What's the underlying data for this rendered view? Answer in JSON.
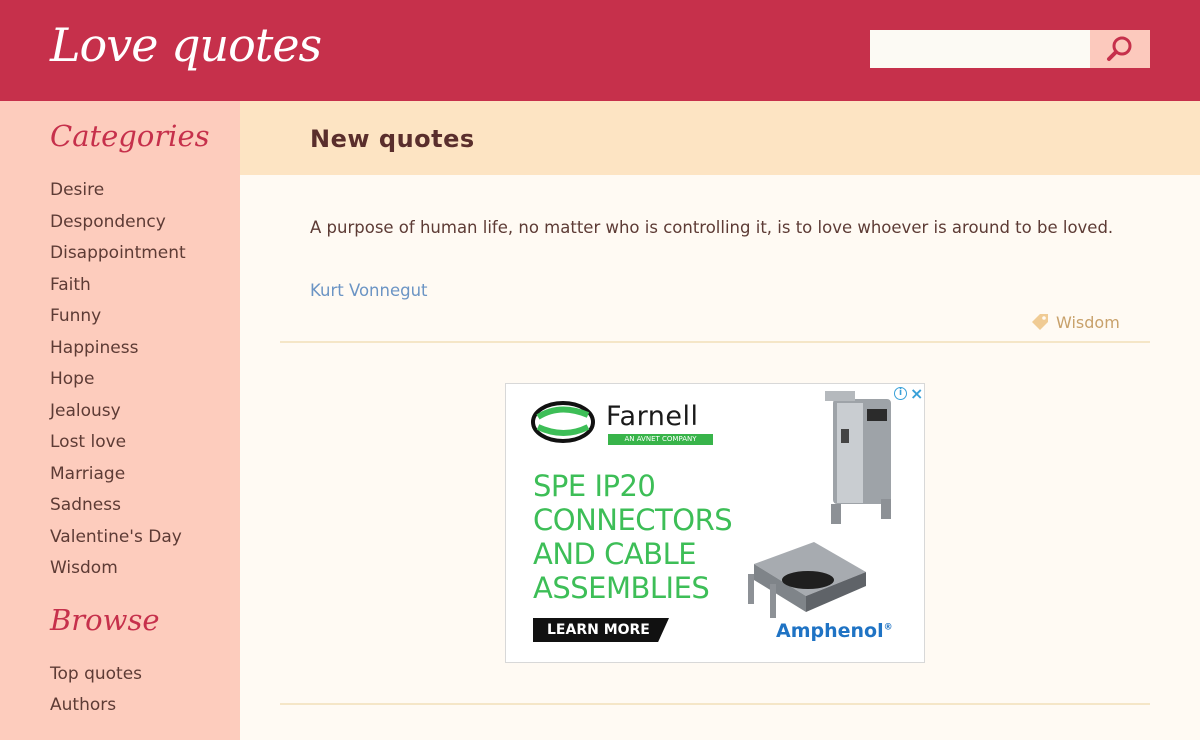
{
  "header": {
    "logo_text": "Love quotes",
    "search": {
      "placeholder": "",
      "value": "",
      "button_icon": "search-icon"
    }
  },
  "sidebar": {
    "categories_heading": "Categories",
    "categories": [
      "Desire",
      "Despondency",
      "Disappointment",
      "Faith",
      "Funny",
      "Happiness",
      "Hope",
      "Jealousy",
      "Lost love",
      "Marriage",
      "Sadness",
      "Valentine's Day",
      "Wisdom"
    ],
    "browse_heading": "Browse",
    "browse": [
      "Top quotes",
      "Authors"
    ]
  },
  "main": {
    "title": "New quotes",
    "quote": {
      "text": "A purpose of human life, no matter who is controlling it, is to love whoever is around to be loved.",
      "author": "Kurt Vonnegut",
      "tag": "Wisdom",
      "tag_icon": "tag-icon"
    }
  },
  "ad": {
    "brand": "Farnell",
    "brand_sub": "AN AVNET COMPANY",
    "headline": [
      "SPE IP20",
      "CONNECTORS",
      "AND CABLE",
      "ASSEMBLIES"
    ],
    "cta": "LEARN MORE",
    "partner": "Amphenol",
    "info_icon": "info-icon",
    "close_icon": "close-icon"
  },
  "colors": {
    "header_bg": "#c6304b",
    "sidebar_bg": "#fdccbd",
    "title_band_bg": "#fde4c3",
    "page_bg": "#fffaf3",
    "author_link": "#6b94c4",
    "tag": "#c8a16b",
    "ad_green": "#3dbe57",
    "ad_blue": "#1f73c4"
  }
}
